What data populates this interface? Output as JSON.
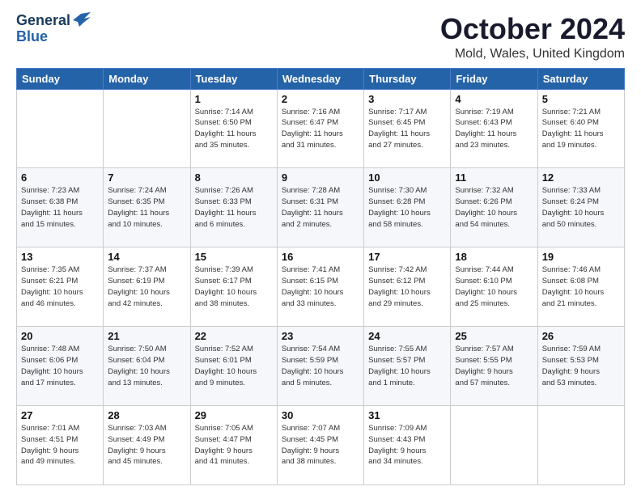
{
  "header": {
    "logo_line1": "General",
    "logo_line2": "Blue",
    "month_title": "October 2024",
    "location": "Mold, Wales, United Kingdom"
  },
  "weekdays": [
    "Sunday",
    "Monday",
    "Tuesday",
    "Wednesday",
    "Thursday",
    "Friday",
    "Saturday"
  ],
  "weeks": [
    [
      {
        "day": "",
        "info": ""
      },
      {
        "day": "",
        "info": ""
      },
      {
        "day": "1",
        "info": "Sunrise: 7:14 AM\nSunset: 6:50 PM\nDaylight: 11 hours\nand 35 minutes."
      },
      {
        "day": "2",
        "info": "Sunrise: 7:16 AM\nSunset: 6:47 PM\nDaylight: 11 hours\nand 31 minutes."
      },
      {
        "day": "3",
        "info": "Sunrise: 7:17 AM\nSunset: 6:45 PM\nDaylight: 11 hours\nand 27 minutes."
      },
      {
        "day": "4",
        "info": "Sunrise: 7:19 AM\nSunset: 6:43 PM\nDaylight: 11 hours\nand 23 minutes."
      },
      {
        "day": "5",
        "info": "Sunrise: 7:21 AM\nSunset: 6:40 PM\nDaylight: 11 hours\nand 19 minutes."
      }
    ],
    [
      {
        "day": "6",
        "info": "Sunrise: 7:23 AM\nSunset: 6:38 PM\nDaylight: 11 hours\nand 15 minutes."
      },
      {
        "day": "7",
        "info": "Sunrise: 7:24 AM\nSunset: 6:35 PM\nDaylight: 11 hours\nand 10 minutes."
      },
      {
        "day": "8",
        "info": "Sunrise: 7:26 AM\nSunset: 6:33 PM\nDaylight: 11 hours\nand 6 minutes."
      },
      {
        "day": "9",
        "info": "Sunrise: 7:28 AM\nSunset: 6:31 PM\nDaylight: 11 hours\nand 2 minutes."
      },
      {
        "day": "10",
        "info": "Sunrise: 7:30 AM\nSunset: 6:28 PM\nDaylight: 10 hours\nand 58 minutes."
      },
      {
        "day": "11",
        "info": "Sunrise: 7:32 AM\nSunset: 6:26 PM\nDaylight: 10 hours\nand 54 minutes."
      },
      {
        "day": "12",
        "info": "Sunrise: 7:33 AM\nSunset: 6:24 PM\nDaylight: 10 hours\nand 50 minutes."
      }
    ],
    [
      {
        "day": "13",
        "info": "Sunrise: 7:35 AM\nSunset: 6:21 PM\nDaylight: 10 hours\nand 46 minutes."
      },
      {
        "day": "14",
        "info": "Sunrise: 7:37 AM\nSunset: 6:19 PM\nDaylight: 10 hours\nand 42 minutes."
      },
      {
        "day": "15",
        "info": "Sunrise: 7:39 AM\nSunset: 6:17 PM\nDaylight: 10 hours\nand 38 minutes."
      },
      {
        "day": "16",
        "info": "Sunrise: 7:41 AM\nSunset: 6:15 PM\nDaylight: 10 hours\nand 33 minutes."
      },
      {
        "day": "17",
        "info": "Sunrise: 7:42 AM\nSunset: 6:12 PM\nDaylight: 10 hours\nand 29 minutes."
      },
      {
        "day": "18",
        "info": "Sunrise: 7:44 AM\nSunset: 6:10 PM\nDaylight: 10 hours\nand 25 minutes."
      },
      {
        "day": "19",
        "info": "Sunrise: 7:46 AM\nSunset: 6:08 PM\nDaylight: 10 hours\nand 21 minutes."
      }
    ],
    [
      {
        "day": "20",
        "info": "Sunrise: 7:48 AM\nSunset: 6:06 PM\nDaylight: 10 hours\nand 17 minutes."
      },
      {
        "day": "21",
        "info": "Sunrise: 7:50 AM\nSunset: 6:04 PM\nDaylight: 10 hours\nand 13 minutes."
      },
      {
        "day": "22",
        "info": "Sunrise: 7:52 AM\nSunset: 6:01 PM\nDaylight: 10 hours\nand 9 minutes."
      },
      {
        "day": "23",
        "info": "Sunrise: 7:54 AM\nSunset: 5:59 PM\nDaylight: 10 hours\nand 5 minutes."
      },
      {
        "day": "24",
        "info": "Sunrise: 7:55 AM\nSunset: 5:57 PM\nDaylight: 10 hours\nand 1 minute."
      },
      {
        "day": "25",
        "info": "Sunrise: 7:57 AM\nSunset: 5:55 PM\nDaylight: 9 hours\nand 57 minutes."
      },
      {
        "day": "26",
        "info": "Sunrise: 7:59 AM\nSunset: 5:53 PM\nDaylight: 9 hours\nand 53 minutes."
      }
    ],
    [
      {
        "day": "27",
        "info": "Sunrise: 7:01 AM\nSunset: 4:51 PM\nDaylight: 9 hours\nand 49 minutes."
      },
      {
        "day": "28",
        "info": "Sunrise: 7:03 AM\nSunset: 4:49 PM\nDaylight: 9 hours\nand 45 minutes."
      },
      {
        "day": "29",
        "info": "Sunrise: 7:05 AM\nSunset: 4:47 PM\nDaylight: 9 hours\nand 41 minutes."
      },
      {
        "day": "30",
        "info": "Sunrise: 7:07 AM\nSunset: 4:45 PM\nDaylight: 9 hours\nand 38 minutes."
      },
      {
        "day": "31",
        "info": "Sunrise: 7:09 AM\nSunset: 4:43 PM\nDaylight: 9 hours\nand 34 minutes."
      },
      {
        "day": "",
        "info": ""
      },
      {
        "day": "",
        "info": ""
      }
    ]
  ]
}
